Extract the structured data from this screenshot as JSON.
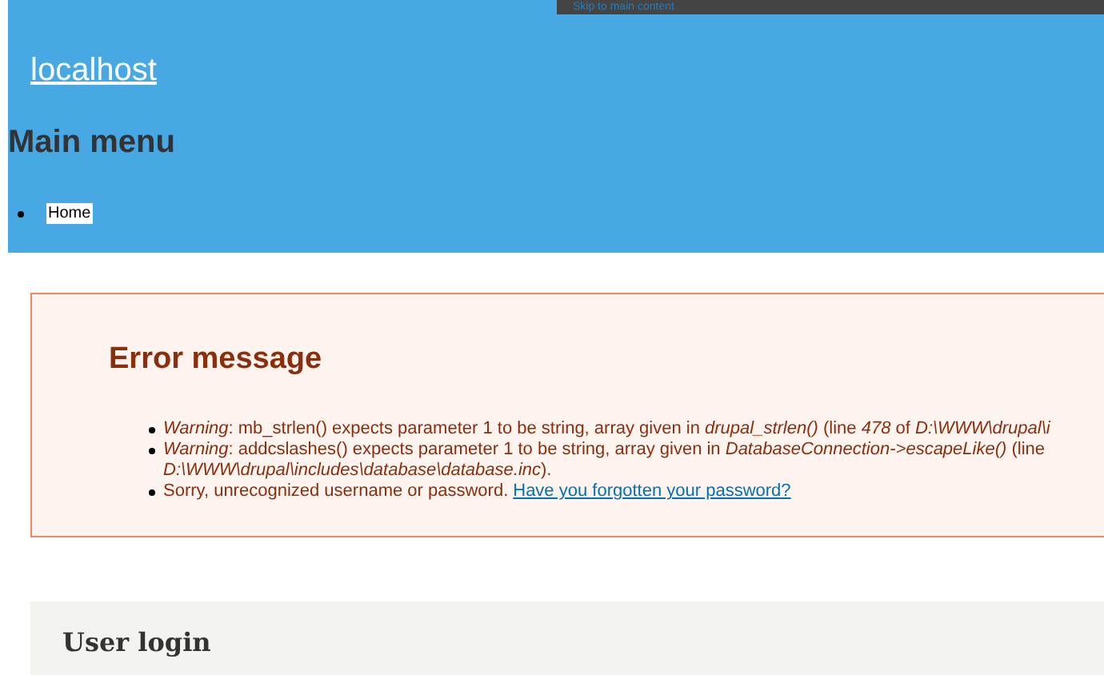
{
  "skip_link": "Skip to main content",
  "site_name": "localhost",
  "menu": {
    "title": "Main menu",
    "items": [
      {
        "label": "Home"
      }
    ]
  },
  "error": {
    "title": "Error message",
    "items": [
      {
        "lines": [
          "*Warning*: mb_strlen() expects parameter 1 to be string, array given in *drupal_strlen()* (line *478* of *D:\\WWW\\drupal\\i*"
        ]
      },
      {
        "lines": [
          "*Warning*: addcslashes() expects parameter 1 to be string, array given in *DatabaseConnection->escapeLike()* (line",
          "*D:\\WWW\\drupal\\includes\\database\\database.inc*)."
        ]
      },
      {
        "lines": [
          "Sorry, unrecognized username or password."
        ],
        "link": "Have you forgotten your password?"
      }
    ]
  },
  "login": {
    "title": "User login"
  }
}
